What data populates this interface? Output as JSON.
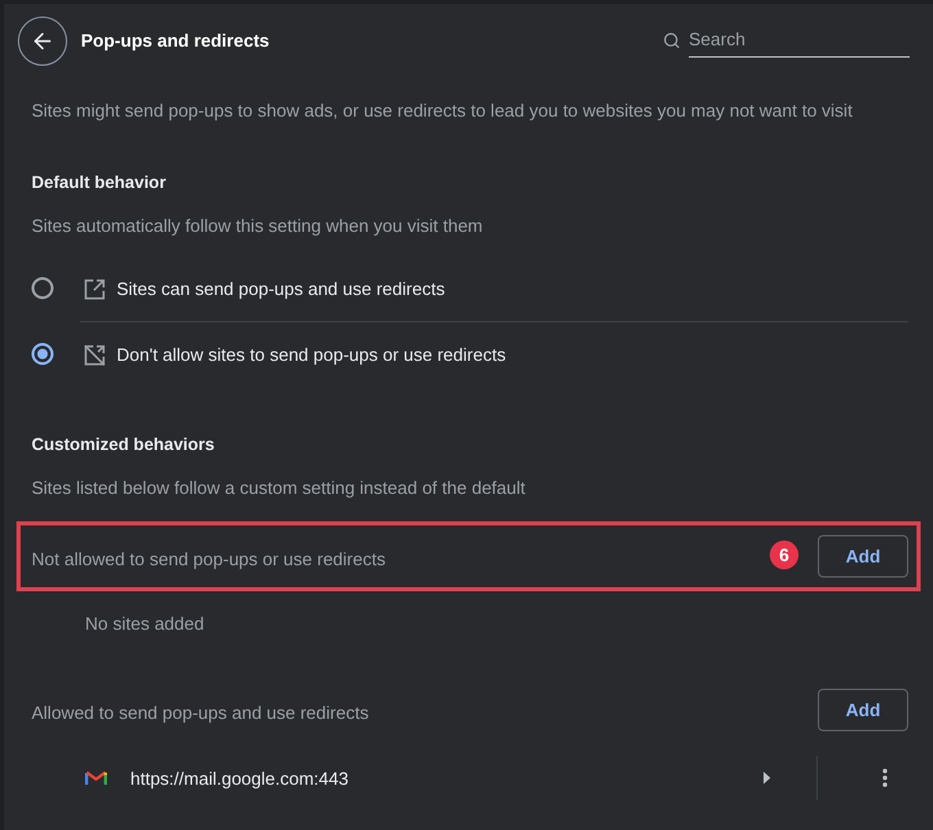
{
  "header": {
    "title": "Pop-ups and redirects",
    "search": {
      "placeholder": "Search"
    }
  },
  "description": "Sites might send pop-ups to show ads, or use redirects to lead you to websites you may not want to visit",
  "default_behavior": {
    "heading": "Default behavior",
    "subtitle": "Sites automatically follow this setting when you visit them",
    "options": [
      {
        "kind": "allow",
        "label": "Sites can send pop-ups and use redirects",
        "selected": false
      },
      {
        "kind": "block",
        "label": "Don't allow sites to send pop-ups or use redirects",
        "selected": true
      }
    ]
  },
  "customized_behaviors": {
    "heading": "Customized behaviors",
    "subtitle": "Sites listed below follow a custom setting instead of the default",
    "lists": [
      {
        "title": "Not allowed to send pop-ups or use redirects",
        "highlighted": true,
        "badge": "6",
        "button": "Add",
        "empty_text": "No sites added"
      },
      {
        "title": "Allowed to send pop-ups and use redirects",
        "highlighted": false,
        "button": "Add",
        "sites": [
          {
            "url": "https://mail.google.com:443"
          }
        ]
      }
    ]
  }
}
